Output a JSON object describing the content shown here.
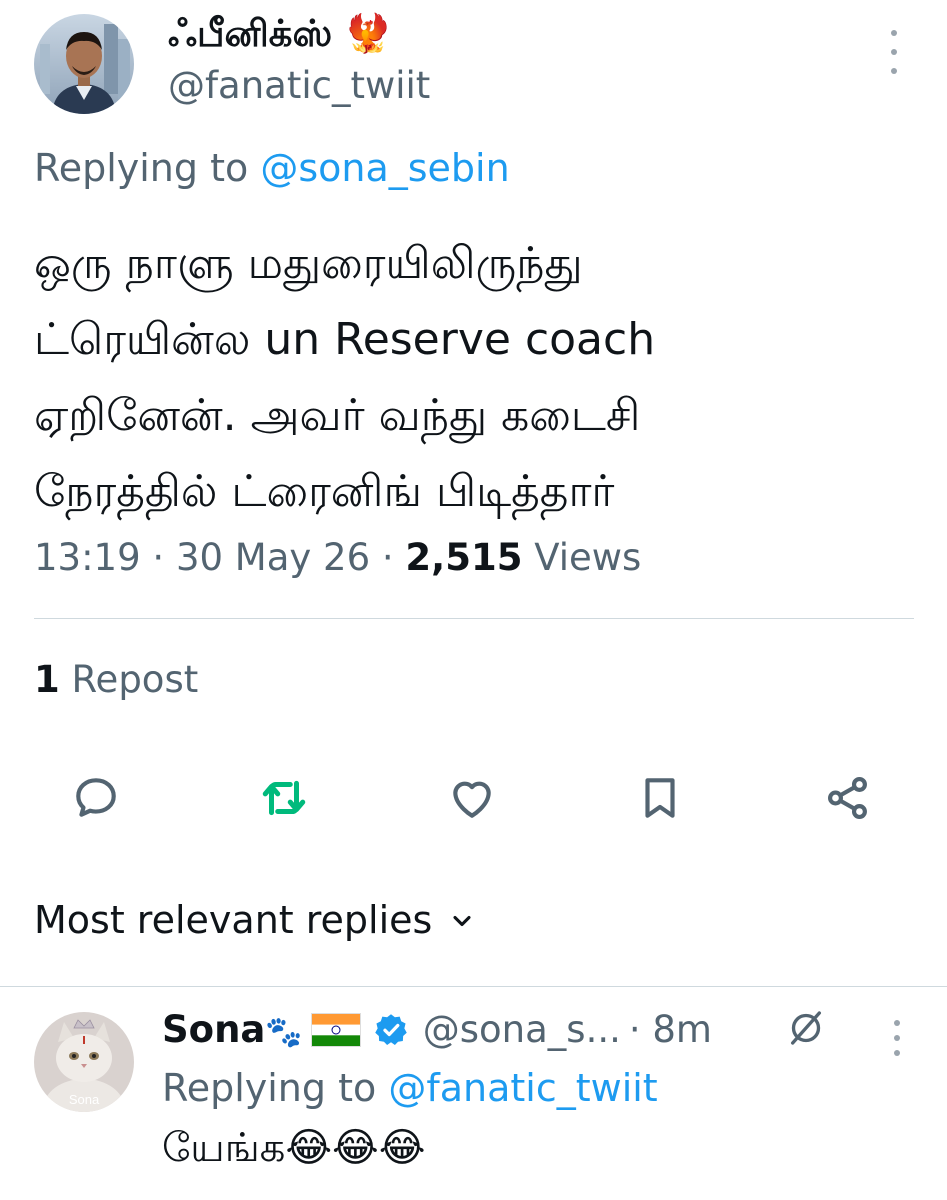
{
  "tweet": {
    "display_name": "ஃபீனிக்ஸ்",
    "display_name_emoji": "🐦‍🔥",
    "handle": "@fanatic_twiit",
    "replying_prefix": "Replying to",
    "replying_to": "@sona_sebin",
    "text_lines": [
      "ஒரு நாளு மதுரையிலிருந்து",
      "ட்ரெயின்ல un Reserve coach",
      "ஏறினேன். அவர் வந்து கடைசி",
      "நேரத்தில் ட்ரைனிங்  பிடித்தார்"
    ],
    "time": "13:19",
    "date": "30 May 26",
    "views_count": "2,515",
    "views_label": "Views",
    "separator": "·",
    "repost_count": "1",
    "repost_label": "Repost"
  },
  "actions": {
    "reply_icon": "comment-icon",
    "repost_icon": "repost-icon",
    "like_icon": "heart-icon",
    "bookmark_icon": "bookmark-icon",
    "share_icon": "share-icon",
    "repost_color": "#00ba7c"
  },
  "replies_section": {
    "label": "Most relevant replies"
  },
  "reply": {
    "name": "Sona",
    "name_emoji": "🐾",
    "handle": "@sona_s...",
    "time": "· 8m",
    "avatar_label": "Sona",
    "replying_prefix": "Replying to",
    "replying_to": "@fanatic_twiit",
    "text": "யேங்க😂😂😂"
  },
  "colors": {
    "link": "#1d9bf0",
    "secondary": "#536471",
    "primary": "#0f1419",
    "verified": "#1d9bf0"
  }
}
